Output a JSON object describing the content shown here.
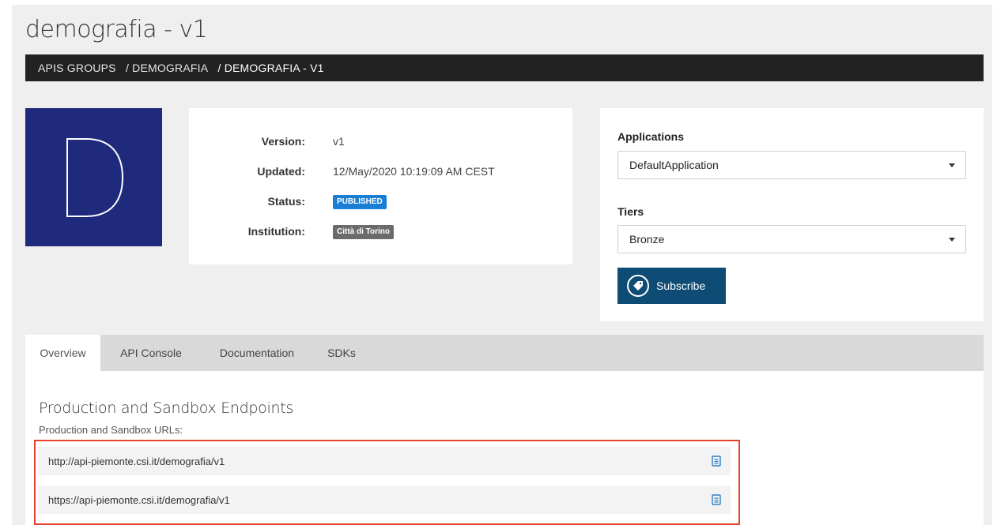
{
  "page": {
    "title": "demografia - v1"
  },
  "breadcrumb": {
    "items": [
      "APIS GROUPS",
      "/ DEMOGRAFIA",
      "/ DEMOGRAFIA - V1"
    ]
  },
  "logo": {
    "letter": "D",
    "color": "#1f2a7c"
  },
  "info": {
    "version_label": "Version:",
    "version_value": "v1",
    "updated_label": "Updated:",
    "updated_value": "12/May/2020 10:19:09 AM CEST",
    "status_label": "Status:",
    "status_value": "PUBLISHED",
    "institution_label": "Institution:",
    "institution_value": "Città di Torino"
  },
  "subscription": {
    "applications_label": "Applications",
    "applications_selected": "DefaultApplication",
    "tiers_label": "Tiers",
    "tiers_selected": "Bronze",
    "subscribe_label": "Subscribe",
    "button_color": "#0f4c75"
  },
  "tabs": [
    {
      "label": "Overview",
      "active": true
    },
    {
      "label": "API Console",
      "active": false
    },
    {
      "label": "Documentation",
      "active": false
    },
    {
      "label": "SDKs",
      "active": false
    }
  ],
  "endpoints": {
    "title": "Production and Sandbox Endpoints",
    "subtitle": "Production and Sandbox URLs:",
    "urls": [
      "http://api-piemonte.csi.it/demografia/v1",
      "https://api-piemonte.csi.it/demografia/v1"
    ],
    "copy_icon": "clipboard-icon",
    "highlight_color": "#e8402f"
  },
  "colors": {
    "breadcrumb_bg": "#222222",
    "published_badge": "#1a7fd4",
    "institution_badge": "#6b6b6b"
  }
}
